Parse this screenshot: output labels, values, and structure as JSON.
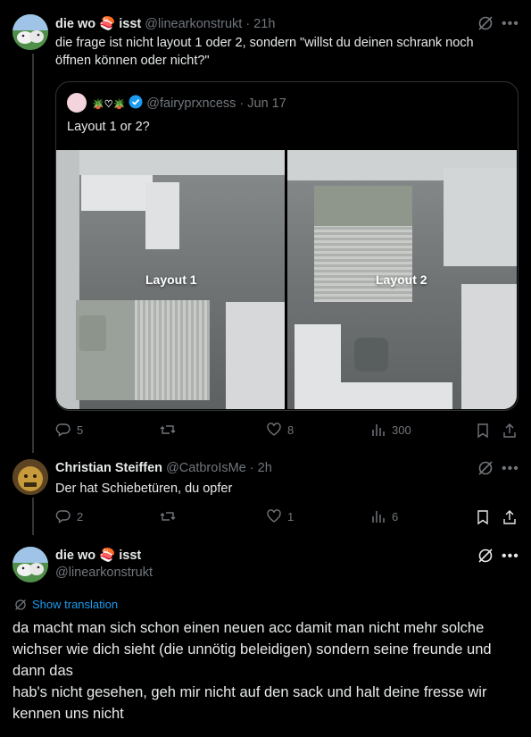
{
  "tweet1": {
    "display_name": "die wo",
    "name_emoji": "🍣",
    "display_name_end": "isst",
    "handle": "@linearkonstrukt",
    "time": "· 21h",
    "text": "die frage ist nicht layout 1 oder 2, sondern \"willst du deinen schrank noch öffnen können oder nicht?\""
  },
  "quote": {
    "display_name": "🪴♡🪴",
    "handle": "@fairyprxncess",
    "time": "· Jun 17",
    "text": "Layout 1 or 2?",
    "image_labels": [
      "Layout 1",
      "Layout 2"
    ]
  },
  "tweet1_actions": {
    "replies": "5",
    "retweets": "",
    "likes": "8",
    "views": "300"
  },
  "tweet2": {
    "display_name": "Christian Steiffen",
    "handle": "@CatbroIsMe",
    "time": "· 2h",
    "text": "Der hat Schiebetüren, du opfer"
  },
  "tweet2_actions": {
    "replies": "2",
    "retweets": "",
    "likes": "1",
    "views": "6"
  },
  "tweet3": {
    "display_name": "die wo",
    "name_emoji": "🍣",
    "display_name_end": "isst",
    "handle": "@linearkonstrukt",
    "show_translation": "Show translation",
    "text_line1": "da macht man sich schon einen neuen acc damit man nicht mehr solche wichser wie dich sieht (die unnötig beleidigen) sondern seine freunde und dann das",
    "text_line2": "hab's nicht gesehen, geh mir nicht auf den sack und halt deine fresse wir kennen uns nicht"
  },
  "colors": {
    "background": "#000000",
    "text": "#e7e9ea",
    "muted": "#71767b",
    "link": "#1d9bf0",
    "border": "#2f3336"
  }
}
